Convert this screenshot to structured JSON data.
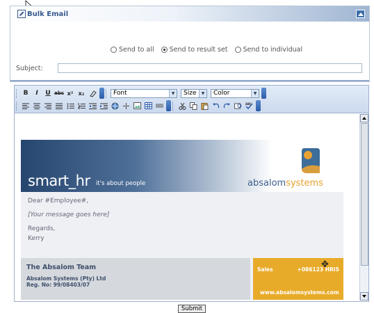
{
  "panel": {
    "title": "Bulk Email",
    "radios": [
      {
        "label": "Send to all",
        "selected": false
      },
      {
        "label": "Send to result set",
        "selected": true
      },
      {
        "label": "Send to individual",
        "selected": false
      }
    ],
    "subject_label": "Subject:",
    "subject_value": ""
  },
  "toolbar": {
    "font_label": "Font",
    "size_label": "Size",
    "color_label": "Color"
  },
  "email": {
    "brand": "smart_hr",
    "tagline": "it's about people",
    "logo_word_a": "absalom",
    "logo_word_b": "systems",
    "greeting": "Dear #Employee#,",
    "message": "[Your message goes here]",
    "regards": "Regards,",
    "signer": "Kerry",
    "team": "The Absalom Team",
    "company": "Absalom Systems (Pty) Ltd",
    "reg": "Reg. No: 99/08403/07",
    "sales_label": "Sales",
    "sales_phone": "+086123 HRIS",
    "website": "www.absalomsystems.com"
  },
  "submit_label": "Submit",
  "colors": {
    "accent": "#36598e",
    "orange": "#e8ab29",
    "banner_dark": "#27466f"
  }
}
